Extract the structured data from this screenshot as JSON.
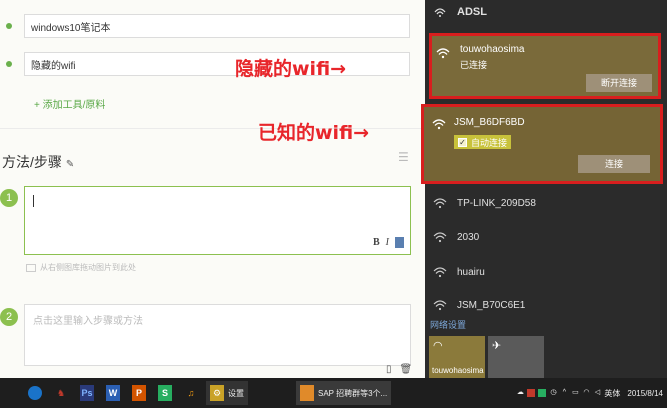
{
  "editor": {
    "tools": [
      "windows10笔记本",
      "隐藏的wifi"
    ],
    "add_tool": "+ 添加工具/原料",
    "section_title": "方法/步骤",
    "pencil_icon": "pencil-icon",
    "step1": "1",
    "step2": "2",
    "step1_placeholder": "",
    "upload_hint": "从右侧图库拖动图片到此处",
    "step2_placeholder": "点击这里输入步骤或方法",
    "format": {
      "bold": "B",
      "italic": "I"
    }
  },
  "annotations": {
    "hidden": "隐藏的wifi→",
    "known": "已知的wifi→"
  },
  "network": {
    "adsl": "ADSL",
    "hidden": {
      "name": "touwohaosima",
      "status": "已连接",
      "button": "断开连接"
    },
    "known": {
      "name": "JSM_B6DF6BD",
      "auto": "自动连接",
      "button": "连接"
    },
    "others": [
      "TP-LINK_209D58",
      "2030",
      "huairu",
      "JSM_B70C6E1"
    ],
    "settings": "网络设置",
    "quick_tile_label": "touwohaosima"
  },
  "taskbar": {
    "apps": [
      "P",
      "W",
      "P",
      "S"
    ],
    "settings_label": "设置",
    "sap_label": "SAP 招聘群等3个...",
    "tray_lang": "英体",
    "date": "2015/8/14"
  },
  "colors": {
    "accent_green": "#8cc04f",
    "annotation_red": "#e8262b",
    "flyout_bg": "#2b2b2b",
    "selected_bg": "#7a6a3a"
  }
}
